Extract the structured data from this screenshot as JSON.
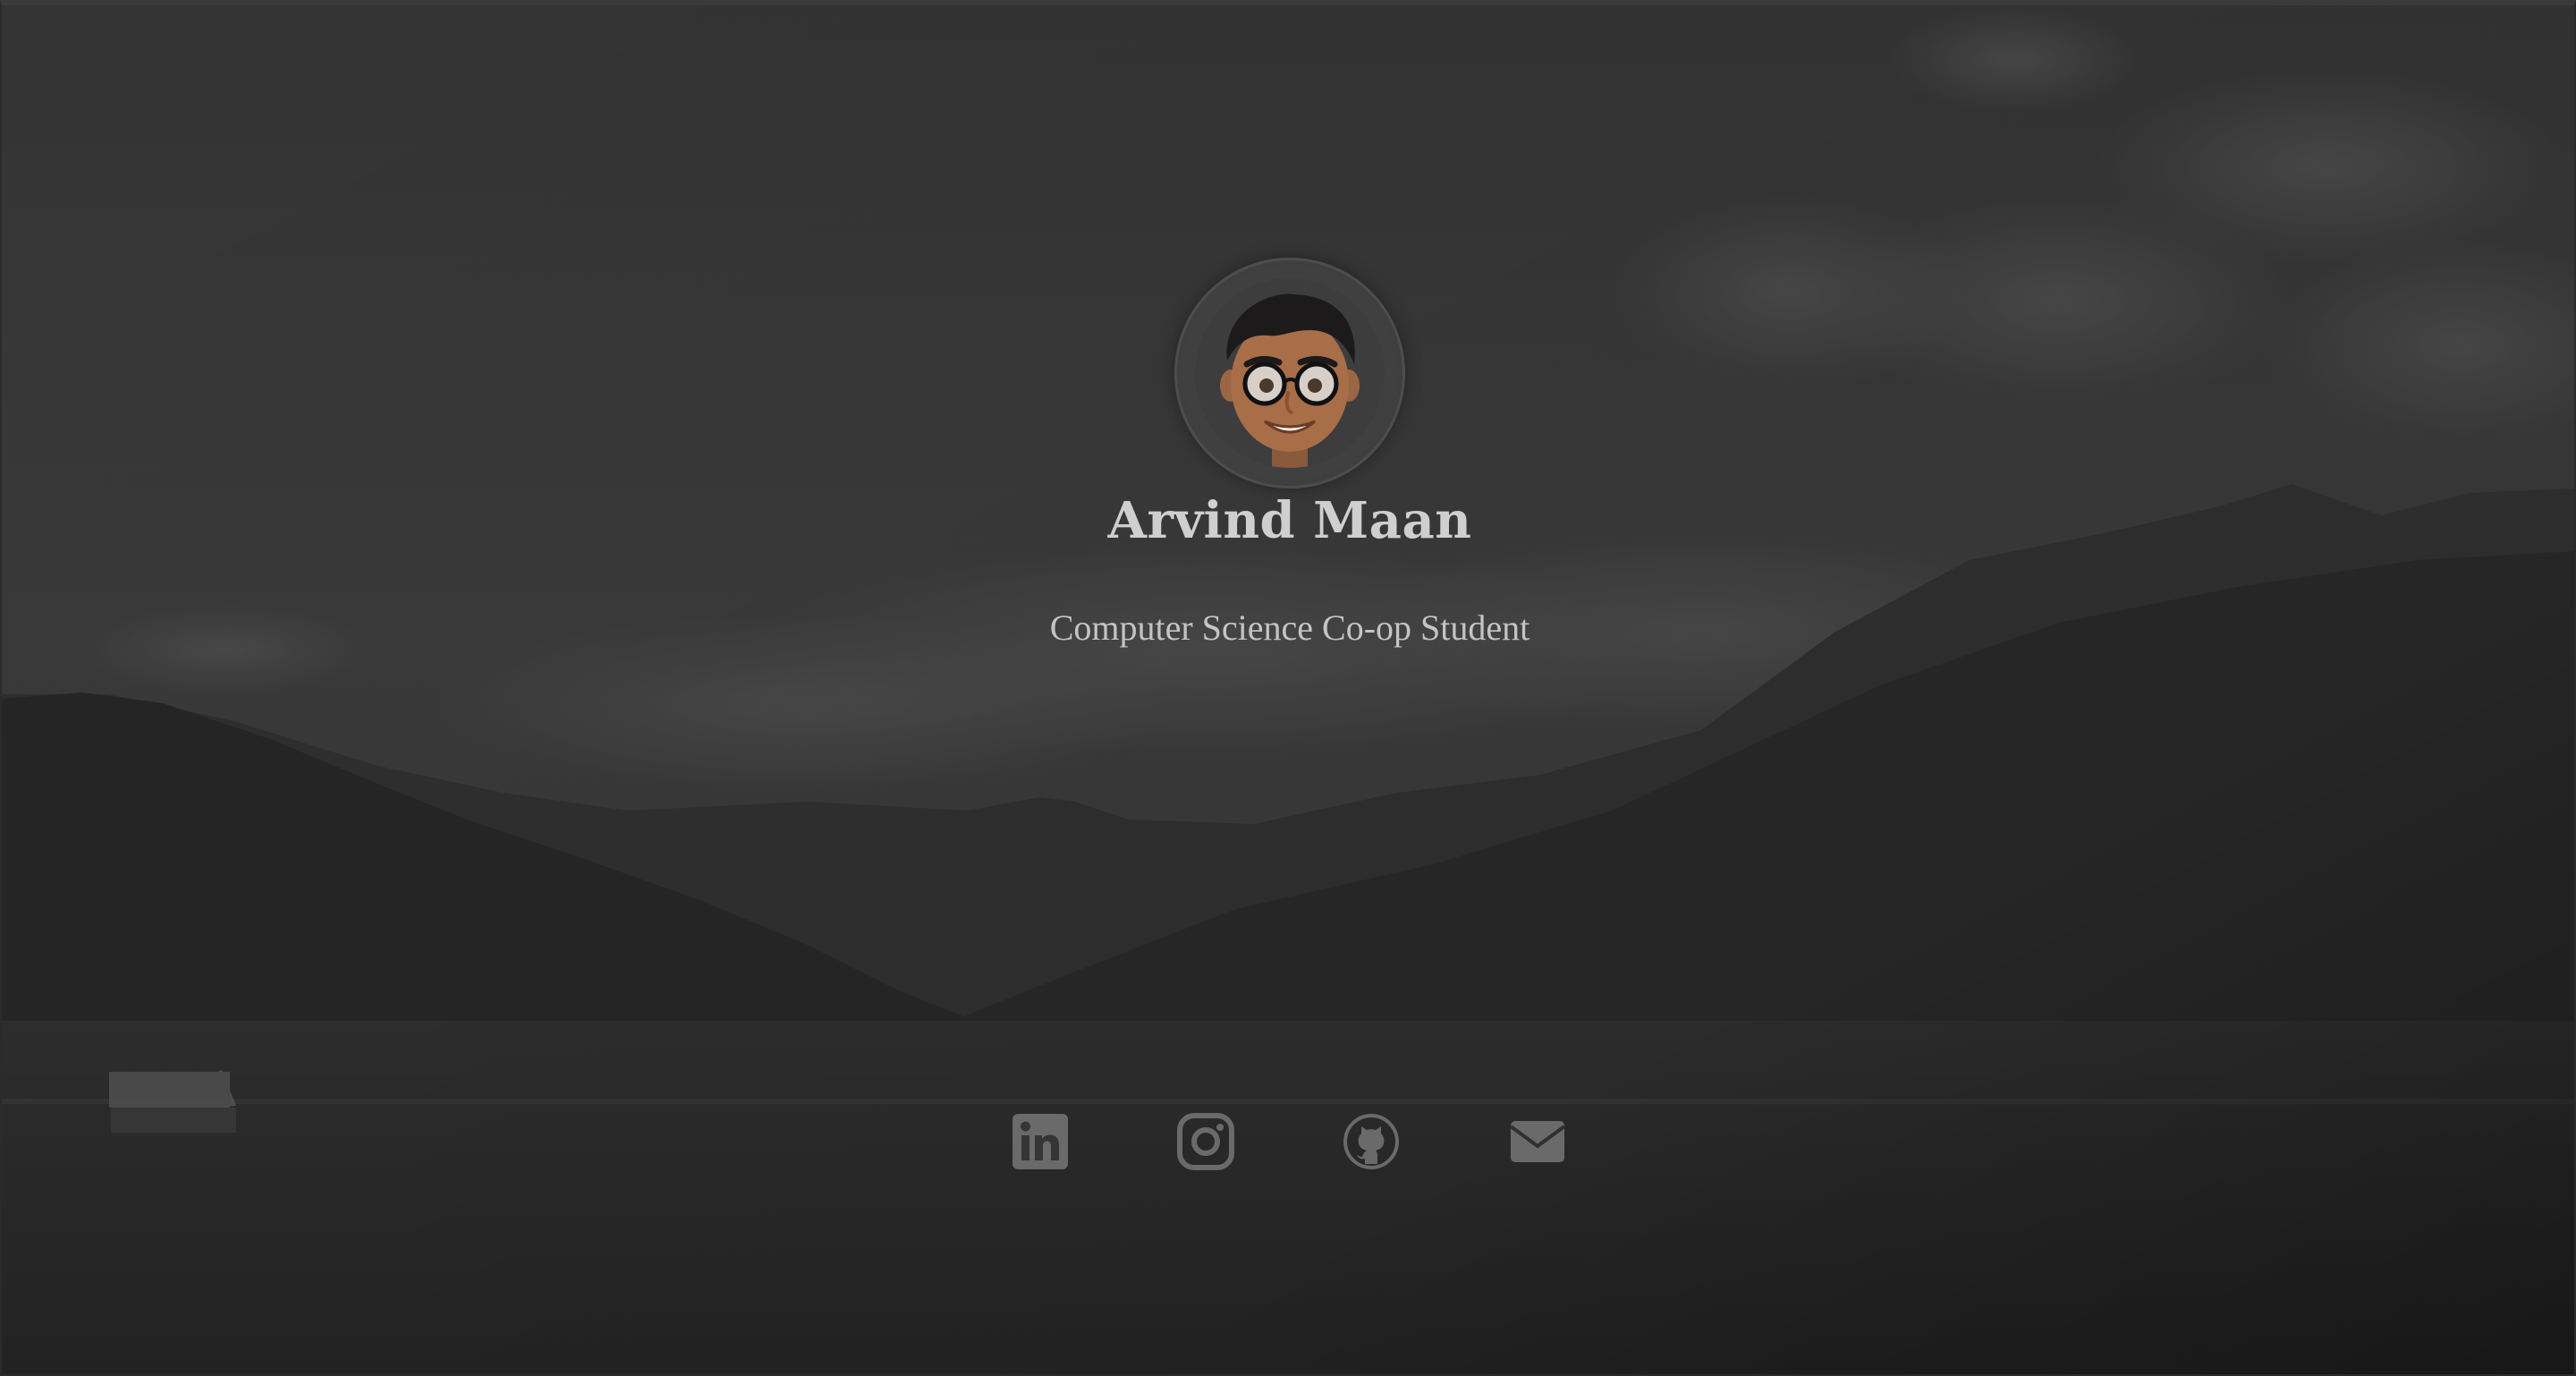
{
  "profile": {
    "name": "Arvind Maan",
    "subtitle": "Computer Science Co-op Student"
  },
  "social_links": [
    {
      "name": "linkedin",
      "icon": "linkedin-icon"
    },
    {
      "name": "instagram",
      "icon": "instagram-icon"
    },
    {
      "name": "github",
      "icon": "github-icon"
    },
    {
      "name": "email",
      "icon": "mail-icon"
    }
  ],
  "colors": {
    "background_overlay": "#2a2a2a",
    "text": "#cfcfcf",
    "icon": "#6a6a6a"
  }
}
